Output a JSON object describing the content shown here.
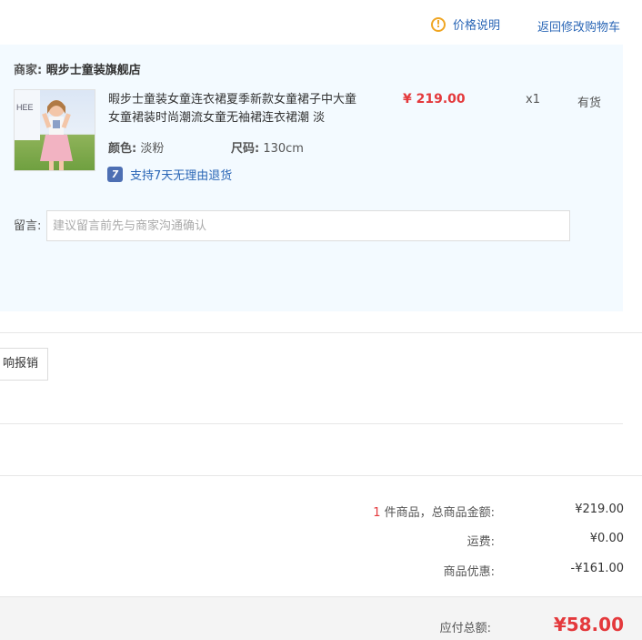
{
  "header": {
    "price_info_label": "价格说明",
    "price_info_icon": "warning-circle-icon",
    "return_cart_label": "返回修改购物车"
  },
  "merchant": {
    "label": "商家:",
    "name": "暇步士童装旗舰店"
  },
  "item": {
    "title": "暇步士童装女童连衣裙夏季新款女童裙子中大童女童裙装时尚潮流女童无袖裙连衣裙潮 淡",
    "price": "¥ 219.00",
    "quantity": "x1",
    "stock": "有货",
    "color_label": "颜色:",
    "color_value": "淡粉",
    "size_label": "尺码:",
    "size_value": "130cm",
    "return_badge": "7",
    "return_text": "支持7天无理由退货"
  },
  "note": {
    "label": "留言:",
    "placeholder": "建议留言前先与商家沟通确认",
    "value": ""
  },
  "tab_button_label": "响报销",
  "summary": {
    "count": "1",
    "items_text": " 件商品，总商品金额:",
    "items_amount": "¥219.00",
    "shipping_label": "运费:",
    "shipping_amount": "¥0.00",
    "discount_label": "商品优惠:",
    "discount_amount": "-¥161.00",
    "total_label": "应付总额:",
    "total_amount": "¥58.00"
  },
  "colors": {
    "accent_red": "#e4393c",
    "link_blue": "#2a66b6",
    "panel_bg": "#f3faff"
  }
}
